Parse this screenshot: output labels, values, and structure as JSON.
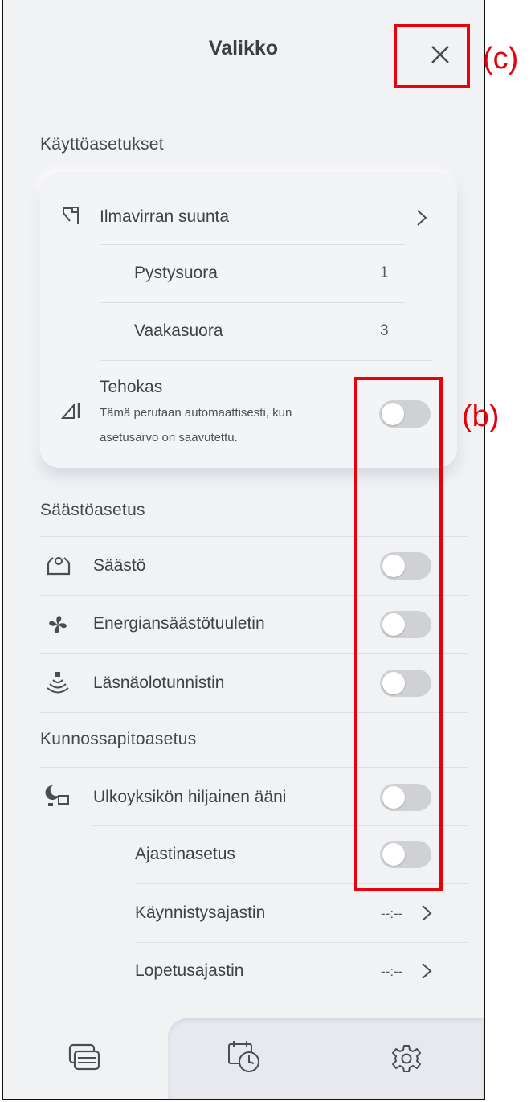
{
  "header": {
    "title": "Valikko"
  },
  "annotations": {
    "b": "(b)",
    "c": "(c)"
  },
  "operation": {
    "heading": "Käyttöasetukset",
    "airflow": {
      "label": "Ilmavirran suunta",
      "vertical_label": "Pystysuora",
      "vertical_value": "1",
      "horizontal_label": "Vaakasuora",
      "horizontal_value": "3"
    },
    "powerful": {
      "label": "Tehokas",
      "description": "Tämä perutaan automaattisesti, kun asetusarvo on saavutettu.",
      "on": false
    }
  },
  "saving": {
    "heading": "Säästöasetus",
    "items": [
      {
        "label": "Säästö",
        "icon": "economy-icon",
        "on": false
      },
      {
        "label": "Energiansäästötuuletin",
        "icon": "fan-icon",
        "on": false
      },
      {
        "label": "Läsnäolotunnistin",
        "icon": "presence-sensor-icon",
        "on": false
      }
    ]
  },
  "maintenance": {
    "heading": "Kunnossapitoasetus",
    "quiet": {
      "label": "Ulkoyksikön hiljainen ääni",
      "icon": "outdoor-quiet-icon",
      "on": false
    },
    "timer_setting": {
      "label": "Ajastinasetus",
      "on": false
    },
    "start_timer": {
      "label": "Käynnistysajastin",
      "value": "--:--"
    },
    "stop_timer": {
      "label": "Lopetusajastin",
      "value": "--:--"
    }
  },
  "colors": {
    "annotation": "#e8000b",
    "toggle_off": "#cfd1d4",
    "background": "#f1f2f4"
  }
}
